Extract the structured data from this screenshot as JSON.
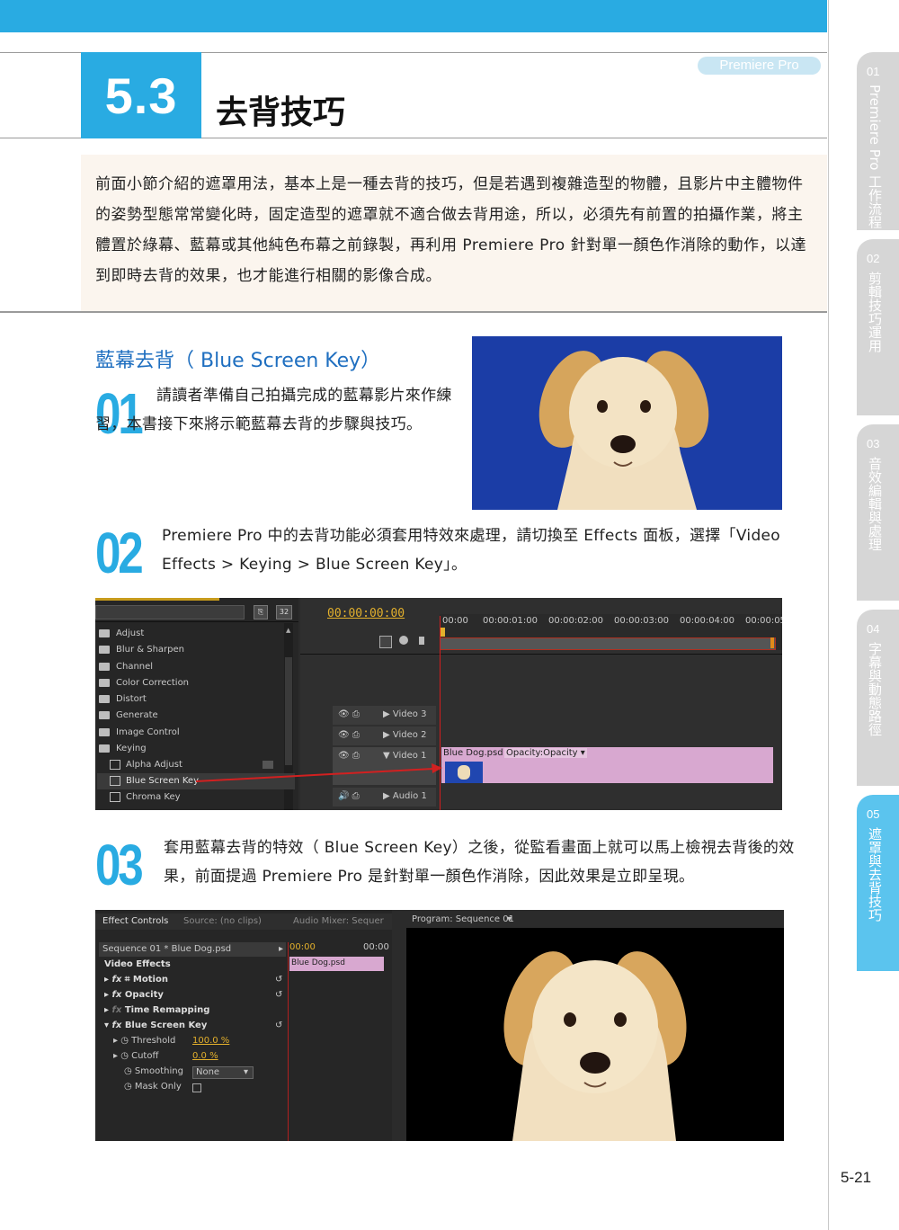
{
  "header": {
    "section_number": "5.3",
    "section_title": "去背技巧",
    "brand": "Premiere Pro"
  },
  "intro": "前面小節介紹的遮罩用法，基本上是一種去背的技巧，但是若遇到複雜造型的物體，且影片中主體物件的姿勢型態常常變化時，固定造型的遮罩就不適合做去背用途，所以，必須先有前置的拍攝作業，將主體置於綠幕、藍幕或其他純色布幕之前錄製，再利用 Premiere Pro 針對單一顏色作消除的動作，以達到即時去背的效果，也才能進行相關的影像合成。",
  "subsection_title": "藍幕去背（ Blue Screen Key）",
  "steps": [
    {
      "number": "01",
      "text": "請讀者準備自己拍攝完成的藍幕影片來作練習，本書接下來將示範藍幕去背的步驟與技巧。"
    },
    {
      "number": "02",
      "text": "Premiere Pro 中的去背功能必須套用特效來處理，請切換至 Effects 面板，選擇「Video Effects > Keying > Blue Screen Key」。"
    },
    {
      "number": "03",
      "text": "套用藍幕去背的特效（ Blue Screen Key）之後，從監看畫面上就可以馬上檢視去背後的效果，前面提過 Premiere Pro 是針對單一顏色作消除，因此效果是立即呈現。"
    }
  ],
  "effects_panel": {
    "badge1": "32",
    "folders": [
      "Adjust",
      "Blur & Sharpen",
      "Channel",
      "Color Correction",
      "Distort",
      "Generate",
      "Image Control",
      "Keying"
    ],
    "keying_items": [
      "Alpha Adjust",
      "Blue Screen Key",
      "Chroma Key"
    ],
    "timecode": "00:00:00:00",
    "ruler": [
      "00:00",
      "00:00:01:00",
      "00:00:02:00",
      "00:00:03:00",
      "00:00:04:00",
      "00:00:05"
    ],
    "tracks": [
      "Video 3",
      "Video 2",
      "Video 1",
      "Audio 1"
    ],
    "clip_name": "Blue Dog.psd",
    "clip_opacity": "Opacity:Opacity"
  },
  "effect_controls": {
    "tabs": [
      "Effect Controls",
      "Source: (no clips)",
      "Audio Mixer: Sequer"
    ],
    "program_tab": "Program: Sequence 01",
    "sequence": "Sequence 01 * Blue Dog.psd",
    "time_start": "00:00",
    "time_end": "00:00",
    "clip_label": "Blue Dog.psd",
    "video_effects": "Video Effects",
    "effects": [
      "Motion",
      "Opacity",
      "Time Remapping",
      "Blue Screen Key"
    ],
    "params": [
      {
        "name": "Threshold",
        "value": "100.0 %"
      },
      {
        "name": "Cutoff",
        "value": "0.0 %"
      },
      {
        "name": "Smoothing",
        "value": "None"
      },
      {
        "name": "Mask Only",
        "value": ""
      }
    ]
  },
  "side_tabs": [
    {
      "num": "01",
      "label": "Premiere Pro 工作流程"
    },
    {
      "num": "02",
      "label": "剪輯技巧運用"
    },
    {
      "num": "03",
      "label": "音效編輯與處理"
    },
    {
      "num": "04",
      "label": "字幕與動態路徑"
    },
    {
      "num": "05",
      "label": "遮罩與去背技巧"
    }
  ],
  "page_number": "5-21",
  "colors": {
    "accent": "#29abe2",
    "clip": "#d8a8d0",
    "bluescreen": "#1a3aa0"
  }
}
